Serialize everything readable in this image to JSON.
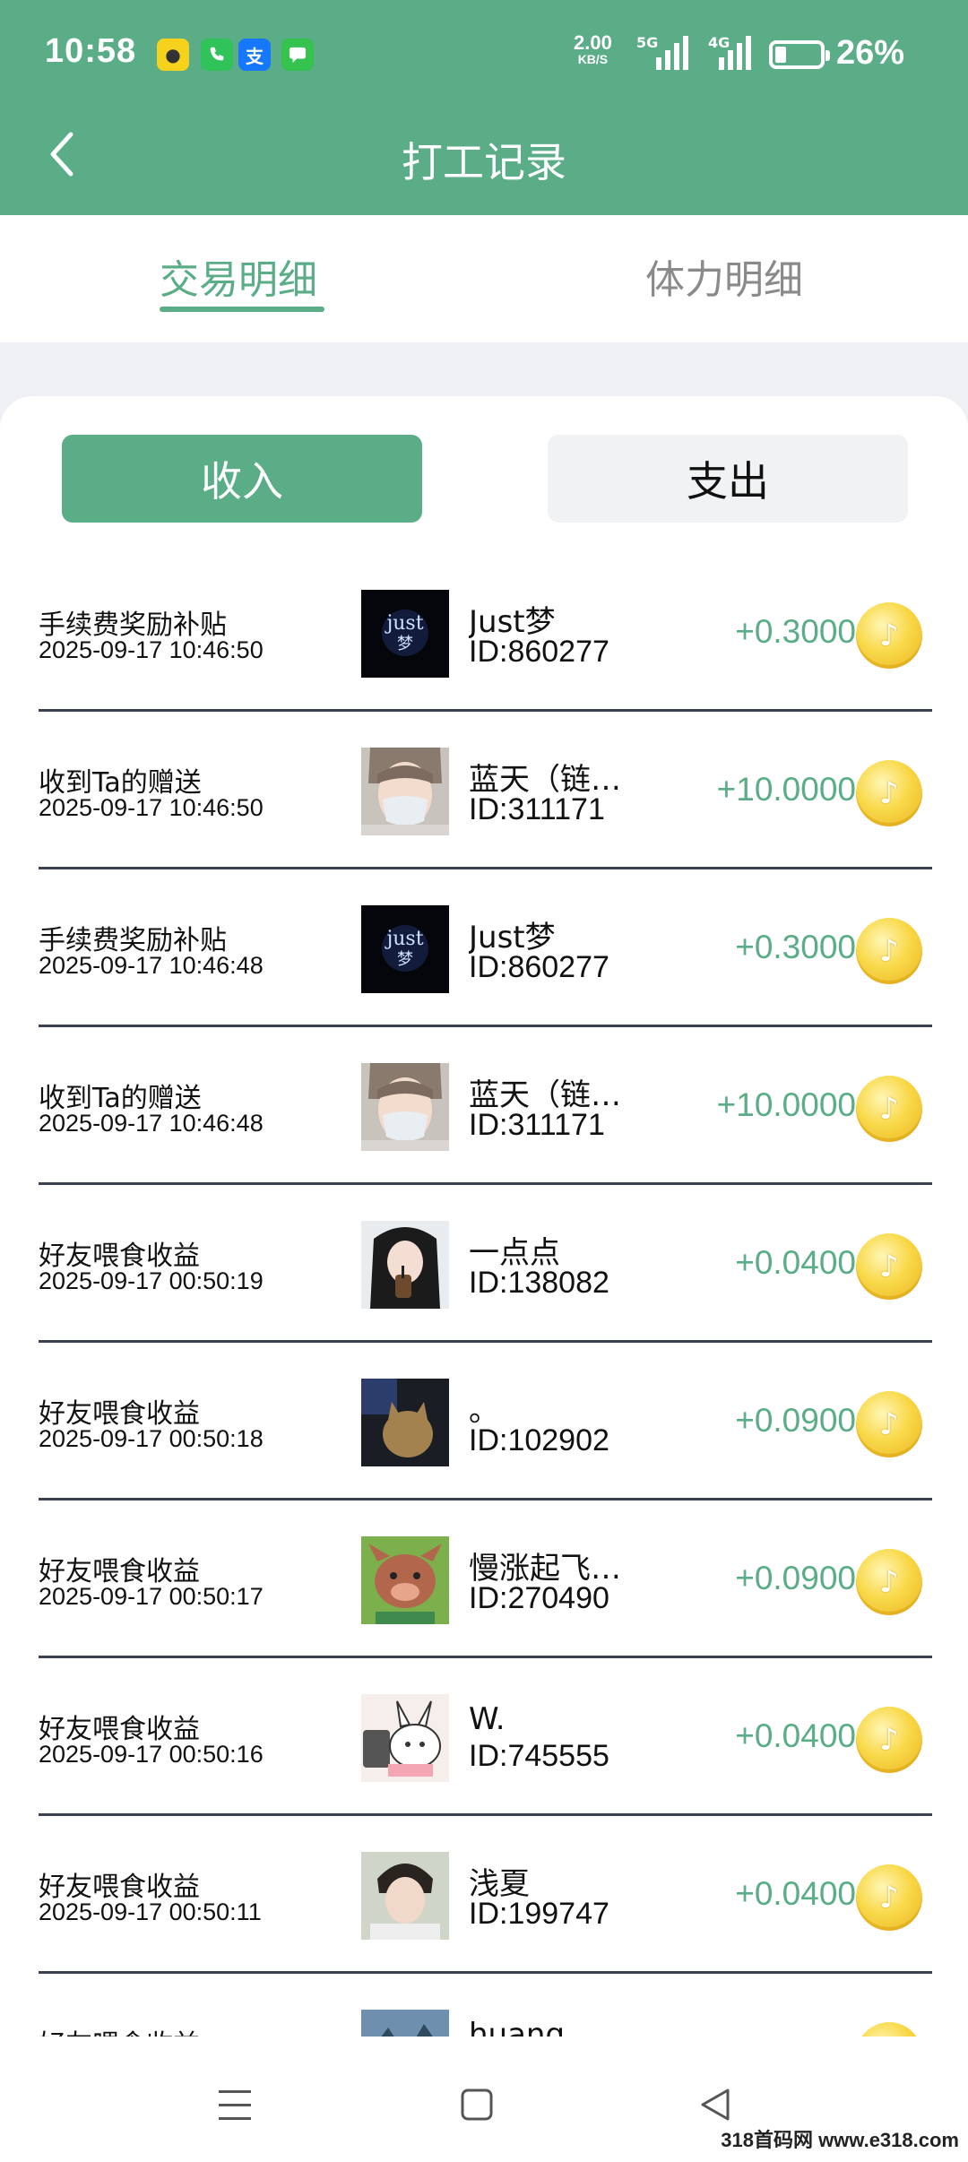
{
  "status_bar": {
    "time": "10:58",
    "net_speed": "2.00",
    "net_speed_unit": "KB/S",
    "net1_label": "5G",
    "net2_label": "4G",
    "battery_pct": "26%",
    "app_icons": [
      "game-app-icon",
      "phone-app-icon",
      "alipay-app-icon",
      "messages-app-icon"
    ]
  },
  "header": {
    "title": "打工记录"
  },
  "tabs": [
    {
      "label": "交易明细",
      "active": true
    },
    {
      "label": "体力明细",
      "active": false
    }
  ],
  "segment": {
    "income_label": "收入",
    "expense_label": "支出",
    "selected": "income"
  },
  "records": [
    {
      "type": "手续费奖励补贴",
      "time": "2025-09-17 10:46:50",
      "name": "Just梦",
      "id": "ID:860277",
      "amount": "+0.3000",
      "avatar": "just-dream-avatar"
    },
    {
      "type": "收到Ta的赠送",
      "time": "2025-09-17 10:46:50",
      "name": "蓝天（链…",
      "id": "ID:311171",
      "amount": "+10.0000",
      "avatar": "masked-person-avatar"
    },
    {
      "type": "手续费奖励补贴",
      "time": "2025-09-17 10:46:48",
      "name": "Just梦",
      "id": "ID:860277",
      "amount": "+0.3000",
      "avatar": "just-dream-avatar"
    },
    {
      "type": "收到Ta的赠送",
      "time": "2025-09-17 10:46:48",
      "name": "蓝天（链…",
      "id": "ID:311171",
      "amount": "+10.0000",
      "avatar": "masked-person-avatar"
    },
    {
      "type": "好友喂食收益",
      "time": "2025-09-17 00:50:19",
      "name": "一点点",
      "id": "ID:138082",
      "amount": "+0.0400",
      "avatar": "girl-drink-avatar"
    },
    {
      "type": "好友喂食收益",
      "time": "2025-09-17 00:50:18",
      "name": "。",
      "id": "ID:102902",
      "amount": "+0.0900",
      "avatar": "cat-avatar"
    },
    {
      "type": "好友喂食收益",
      "time": "2025-09-17 00:50:17",
      "name": "慢涨起飞…",
      "id": "ID:270490",
      "amount": "+0.0900",
      "avatar": "boar-cartoon-avatar"
    },
    {
      "type": "好友喂食收益",
      "time": "2025-09-17 00:50:16",
      "name": "W.",
      "id": "ID:745555",
      "amount": "+0.0400",
      "avatar": "rabbit-cartoon-avatar"
    },
    {
      "type": "好友喂食收益",
      "time": "2025-09-17 00:50:11",
      "name": "浅夏",
      "id": "ID:199747",
      "amount": "+0.0400",
      "avatar": "boy-avatar"
    },
    {
      "type": "好友喂食收益",
      "time": "",
      "name": "huang",
      "id": "",
      "amount": "",
      "avatar": "landscape-avatar"
    }
  ],
  "coin_icon": "coin-icon",
  "watermark": "318首码网 www.e318.com",
  "colors": {
    "brand_green": "#5aad87",
    "divider": "#3a4153"
  }
}
